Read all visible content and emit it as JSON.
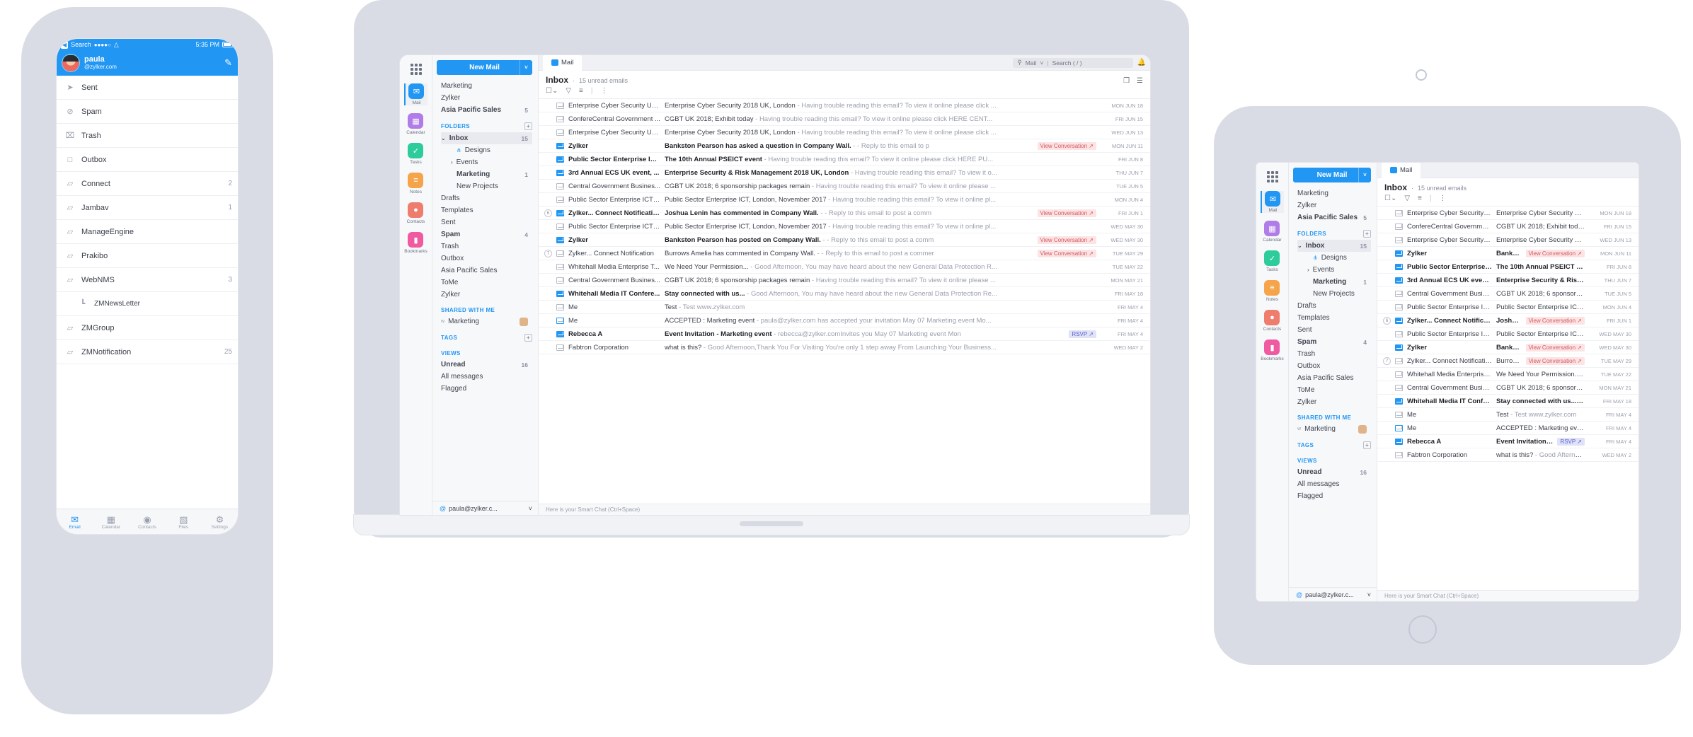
{
  "brand": {
    "accent": "#2196f3",
    "chip_bg": "#fde3e4",
    "chip_fg": "#d05a62",
    "rsvp_bg": "#e0e2f7",
    "rsvp_fg": "#5a62d0"
  },
  "phone": {
    "status": {
      "back": "◀",
      "back_label": "Search",
      "signal": "●●●●○",
      "wifi": "▾",
      "time": "5:35 PM"
    },
    "account": {
      "name": "paula",
      "email": "@zylker.com",
      "compose_icon": "compose-icon"
    },
    "folders": [
      {
        "label": "Sent",
        "icon": "send-icon",
        "count": ""
      },
      {
        "label": "Spam",
        "icon": "ban-icon",
        "count": ""
      },
      {
        "label": "Trash",
        "icon": "trash-icon",
        "count": ""
      },
      {
        "label": "Outbox",
        "icon": "outbox-icon",
        "count": ""
      },
      {
        "label": "Connect",
        "icon": "folder-icon",
        "count": "2"
      },
      {
        "label": "Jambav",
        "icon": "folder-icon",
        "count": "1"
      },
      {
        "label": "ManageEngine",
        "icon": "folder-icon",
        "count": ""
      },
      {
        "label": "Prakibo",
        "icon": "folder-icon",
        "count": ""
      },
      {
        "label": "WebNMS",
        "icon": "folder-icon",
        "count": "3"
      },
      {
        "label": "ZMNewsLetter",
        "icon": "subfolder-icon",
        "count": "",
        "sub": true
      },
      {
        "label": "ZMGroup",
        "icon": "folder-icon",
        "count": ""
      },
      {
        "label": "ZMNotification",
        "icon": "folder-icon",
        "count": "25"
      }
    ],
    "tabs": [
      {
        "label": "Email",
        "icon": "envelope-icon",
        "active": true
      },
      {
        "label": "Calendar",
        "icon": "calendar-icon",
        "active": false
      },
      {
        "label": "Contacts",
        "icon": "contacts-icon",
        "active": false
      },
      {
        "label": "Files",
        "icon": "file-icon",
        "active": false
      },
      {
        "label": "Settings",
        "icon": "gear-icon",
        "active": false
      }
    ]
  },
  "app": {
    "apps_icon": "app-grid-icon",
    "rail": [
      {
        "label": "Mail",
        "icon": "mail-icon",
        "color": "#2196f3",
        "glyph": "✉",
        "active": true
      },
      {
        "label": "Calendar",
        "icon": "calendar-icon",
        "color": "#b07de8",
        "glyph": "▦",
        "active": false
      },
      {
        "label": "Tasks",
        "icon": "tasks-icon",
        "color": "#2fcc9b",
        "glyph": "✓",
        "active": false
      },
      {
        "label": "Notes",
        "icon": "notes-icon",
        "color": "#f5a44a",
        "glyph": "≡",
        "active": false
      },
      {
        "label": "Contacts",
        "icon": "contacts-icon",
        "color": "#ef7d6e",
        "glyph": "●",
        "active": false
      },
      {
        "label": "Bookmarks",
        "icon": "bookmarks-icon",
        "color": "#ef5aa0",
        "glyph": "▮",
        "active": false
      }
    ],
    "new_mail": {
      "label": "New Mail",
      "caret": "˅"
    },
    "accounts": [
      {
        "label": "Marketing",
        "count": ""
      },
      {
        "label": "Zylker",
        "count": ""
      },
      {
        "label": "Asia Pacific Sales",
        "count": "5",
        "bold": true
      }
    ],
    "folders_section": {
      "title": "FOLDERS",
      "add": "+"
    },
    "folders": [
      {
        "label": "Inbox",
        "count": "15",
        "bold": true,
        "selected": true,
        "caret": "⌄"
      },
      {
        "label": "Designs",
        "count": "",
        "indent": 2,
        "icon": "share-icon"
      },
      {
        "label": "Events",
        "count": "",
        "indent": 1,
        "caret": "›"
      },
      {
        "label": "Marketing",
        "count": "1",
        "indent": 2,
        "bold": true
      },
      {
        "label": "New Projects",
        "count": "",
        "indent": 2
      },
      {
        "label": "Drafts",
        "count": ""
      },
      {
        "label": "Templates",
        "count": ""
      },
      {
        "label": "Sent",
        "count": ""
      },
      {
        "label": "Spam",
        "count": "4",
        "bold": true
      },
      {
        "label": "Trash",
        "count": ""
      },
      {
        "label": "Outbox",
        "count": ""
      },
      {
        "label": "Asia Pacific Sales",
        "count": ""
      },
      {
        "label": "ToMe",
        "count": ""
      },
      {
        "label": "Zylker",
        "count": ""
      }
    ],
    "shared_section": {
      "title": "SHARED WITH ME"
    },
    "shared": [
      {
        "label": "Marketing",
        "prefix": "w"
      }
    ],
    "tags_section": {
      "title": "TAGS",
      "add": "+"
    },
    "views_section": {
      "title": "VIEWS"
    },
    "views": [
      {
        "label": "Unread",
        "count": "16",
        "bold": true
      },
      {
        "label": "All messages",
        "count": ""
      },
      {
        "label": "Flagged",
        "count": ""
      }
    ],
    "account_footer": {
      "email": "paula@zylker.c...",
      "caret": "˅",
      "at": "@"
    },
    "tab": {
      "label": "Mail"
    },
    "search": {
      "scope": "Mail",
      "caret": "˅",
      "placeholder": "Search ( / )",
      "icon": "search-icon"
    },
    "bell_icon": "bell-icon",
    "list_header": {
      "title": "Inbox",
      "dot": "·",
      "subtitle": "15 unread emails"
    },
    "list_header_actions": [
      "duplicate-icon",
      "menu-icon"
    ],
    "list_tools": [
      "select-all-checkbox",
      "filter-icon",
      "sort-icon",
      "more-icon"
    ],
    "smart_chat": "Here is your Smart Chat (Ctrl+Space)",
    "emails": [
      {
        "num": "",
        "state": "read",
        "from": "Enterprise Cyber Security UK...",
        "subject": "Enterprise Cyber Security 2018 UK, London",
        "preview": "- Having trouble reading this email? To view it online please click ...",
        "date": "MON JUN 18",
        "chip": ""
      },
      {
        "num": "",
        "state": "read",
        "from": "ConfereCentral Government ...",
        "subject": "CGBT UK 2018; Exhibit today",
        "preview": "- Having trouble reading this email? To view it online please click HERE CENT...",
        "date": "FRI JUN 15",
        "chip": ""
      },
      {
        "num": "",
        "state": "read",
        "from": "Enterprise Cyber Security UK...",
        "subject": "Enterprise Cyber Security 2018 UK, London",
        "preview": "- Having trouble reading this email? To view it online please click ...",
        "date": "WED JUN 13",
        "chip": ""
      },
      {
        "num": "",
        "state": "unread",
        "from": "Zylker",
        "subject": "Bankston Pearson has asked a question in Company Wall.",
        "preview": "- - Reply to this email to p",
        "date": "MON JUN 11",
        "chip": "View Conversation"
      },
      {
        "num": "",
        "state": "unread",
        "from": "Public Sector Enterprise IC...",
        "subject": "The 10th Annual PSEICT event",
        "preview": "- Having trouble reading this email? To view it online please click HERE PU...",
        "date": "FRI JUN 8",
        "chip": ""
      },
      {
        "num": "",
        "state": "unread",
        "from": "3rd Annual ECS UK event, ...",
        "subject": "Enterprise Security & Risk Management 2018 UK, London",
        "preview": "- Having trouble reading this email? To view it o...",
        "date": "THU JUN 7",
        "chip": ""
      },
      {
        "num": "",
        "state": "read",
        "from": "Central Government Busines...",
        "subject": "CGBT UK 2018; 6 sponsorship packages remain",
        "preview": "- Having trouble reading this email? To view it online please ...",
        "date": "TUE JUN 5",
        "chip": ""
      },
      {
        "num": "",
        "state": "read",
        "from": "Public Sector Enterprise ICT ...",
        "subject": "Public Sector Enterprise ICT, London, November 2017",
        "preview": "- Having trouble reading this email? To view it online pl...",
        "date": "MON JUN 4",
        "chip": ""
      },
      {
        "num": "6",
        "state": "unread",
        "from": "Zylker... Connect Notification",
        "subject": "Joshua Lenin has commented in Company Wall.",
        "preview": "- - Reply to this email to post a comm",
        "date": "FRI JUN 1",
        "chip": "View Conversation"
      },
      {
        "num": "",
        "state": "read",
        "from": "Public Sector Enterprise ICT ...",
        "subject": "Public Sector Enterprise ICT, London, November 2017",
        "preview": "- Having trouble reading this email? To view it online pl...",
        "date": "WED MAY 30",
        "chip": ""
      },
      {
        "num": "",
        "state": "unread",
        "from": "Zylker",
        "subject": "Bankston Pearson has posted on Company Wall.",
        "preview": "- - Reply to this email to post a comm",
        "date": "WED MAY 30",
        "chip": "View Conversation"
      },
      {
        "num": "7",
        "state": "read",
        "from": "Zylker... Connect Notification",
        "subject": "Burrows Amelia has commented in Company Wall.",
        "preview": "- - Reply to this email to post a commer",
        "date": "TUE MAY 29",
        "chip": "View Conversation"
      },
      {
        "num": "",
        "state": "read",
        "from": "Whitehall Media Enterprise T...",
        "subject": "We Need Your Permission...",
        "preview": "- Good Afternoon, You may have heard about the new General Data Protection R...",
        "date": "TUE MAY 22",
        "chip": ""
      },
      {
        "num": "",
        "state": "read",
        "from": "Central Government Busines...",
        "subject": "CGBT UK 2018; 6 sponsorship packages remain",
        "preview": "- Having trouble reading this email? To view it online please ...",
        "date": "MON MAY 21",
        "chip": ""
      },
      {
        "num": "",
        "state": "unread",
        "from": "Whitehall Media IT Confere...",
        "subject": "Stay connected with us...",
        "preview": "- Good Afternoon, You may have heard about the new General Data Protection Re...",
        "date": "FRI MAY 18",
        "chip": ""
      },
      {
        "num": "",
        "state": "read",
        "from": "Me",
        "subject": "Test",
        "preview": "- Test www.zylker.com",
        "date": "FRI MAY 4",
        "chip": ""
      },
      {
        "num": "",
        "state": "cal",
        "from": "Me",
        "subject": "ACCEPTED : Marketing event",
        "preview": "- paula@zylker.com has accepted your invitation May 07 Marketing event Mo...",
        "date": "FRI MAY 4",
        "chip": ""
      },
      {
        "num": "",
        "state": "calunread",
        "from": "Rebecca A",
        "subject": "Event Invitation - Marketing event",
        "preview": "- rebecca@zylker.comInvites you May 07 Marketing event Mon",
        "date": "FRI MAY 4",
        "chip": "RSVP"
      },
      {
        "num": "",
        "state": "read",
        "from": "Fabtron Corporation",
        "subject": "what is this?",
        "preview": "- Good Afternoon,Thank You For Visiting You're only 1 step away From Launching Your Business...",
        "date": "WED MAY 2",
        "chip": ""
      }
    ]
  }
}
